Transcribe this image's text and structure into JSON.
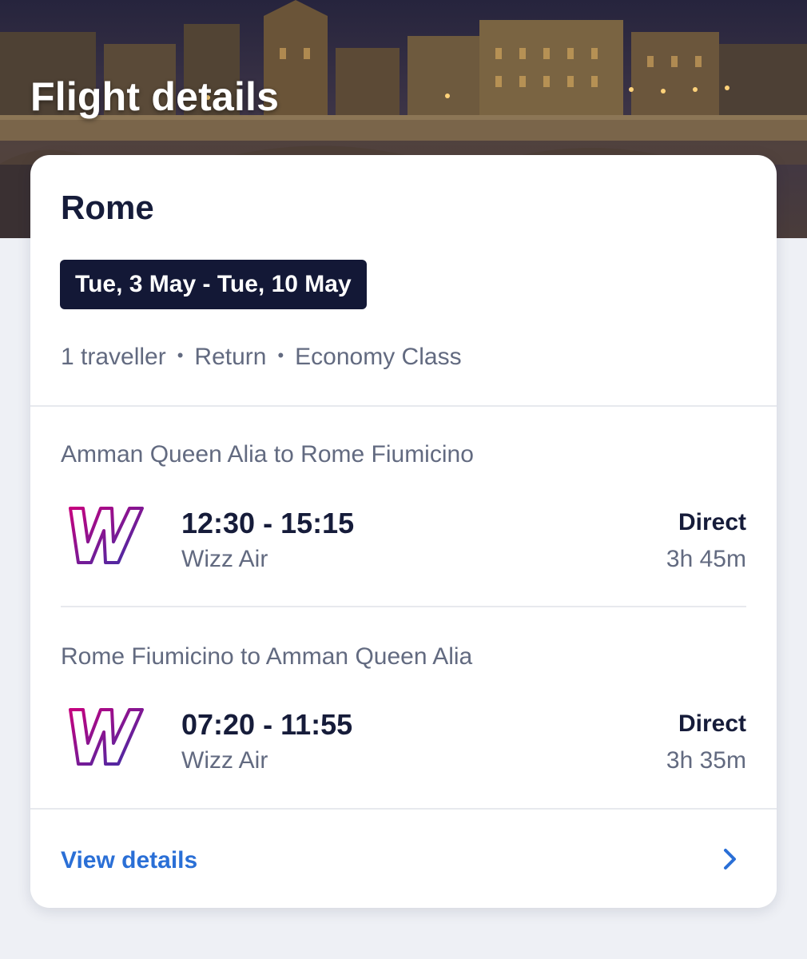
{
  "header": {
    "title": "Flight details"
  },
  "trip": {
    "destination": "Rome",
    "dates": "Tue, 3 May - Tue, 10 May",
    "travellers": "1 traveller",
    "trip_type": "Return",
    "cabin_class": "Economy Class",
    "separator": "•"
  },
  "legs": [
    {
      "route": "Amman Queen Alia to Rome Fiumicino",
      "times": "12:30 - 15:15",
      "airline": "Wizz Air",
      "stops": "Direct",
      "duration": "3h 45m",
      "logo_icon": "wizz-air-logo"
    },
    {
      "route": "Rome Fiumicino to Amman Queen Alia",
      "times": "07:20 - 11:55",
      "airline": "Wizz Air",
      "stops": "Direct",
      "duration": "3h 35m",
      "logo_icon": "wizz-air-logo"
    }
  ],
  "footer": {
    "view_details_label": "View details",
    "chevron_icon": "chevron-right-icon"
  },
  "colors": {
    "accent": "#2a6fd6",
    "badge_bg": "#131836",
    "text_primary": "#161c3a",
    "text_secondary": "#626a80",
    "logo_gradient": [
      "#c6007e",
      "#3b2fa8"
    ]
  }
}
